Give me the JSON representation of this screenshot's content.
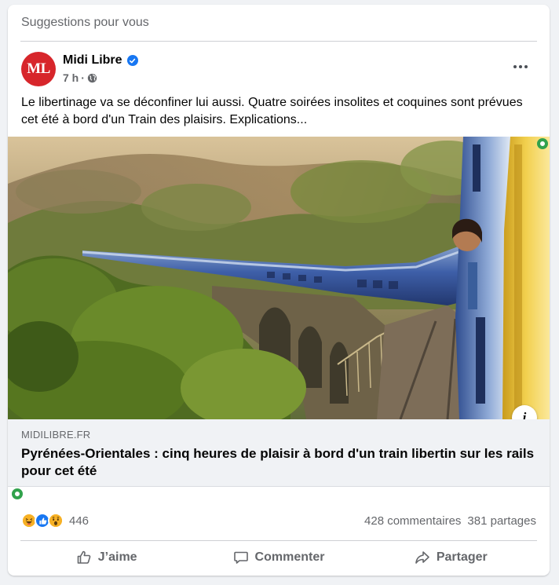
{
  "feed": {
    "section_label": "Suggestions pour vous"
  },
  "post": {
    "author": {
      "name": "Midi Libre",
      "avatar_text": "ML",
      "avatar_color": "#d7262b",
      "verified": true
    },
    "time": "7 h",
    "separator": "·",
    "audience_icon": "globe-icon",
    "text": "Le libertinage va se déconfiner lui aussi. Quatre soirées insolites et coquines sont prévues cet été à bord d'un Train des plaisirs. Explications...",
    "link": {
      "domain": "MIDILIBRE.FR",
      "title": "Pyrénées-Orientales : cinq heures de plaisir à bord d'un train libertin sur les rails pour cet été",
      "info_label": "i"
    },
    "reactions": {
      "icons": [
        "haha-icon",
        "like-icon",
        "wow-icon"
      ],
      "count": "446"
    },
    "stats": {
      "comments": "428 commentaires",
      "shares": "381 partages"
    },
    "actions": {
      "like": "J’aime",
      "comment": "Commenter",
      "share": "Partager"
    }
  },
  "colors": {
    "accent": "#1877f2",
    "online": "#31a24c",
    "secondary_text": "#65676b"
  }
}
